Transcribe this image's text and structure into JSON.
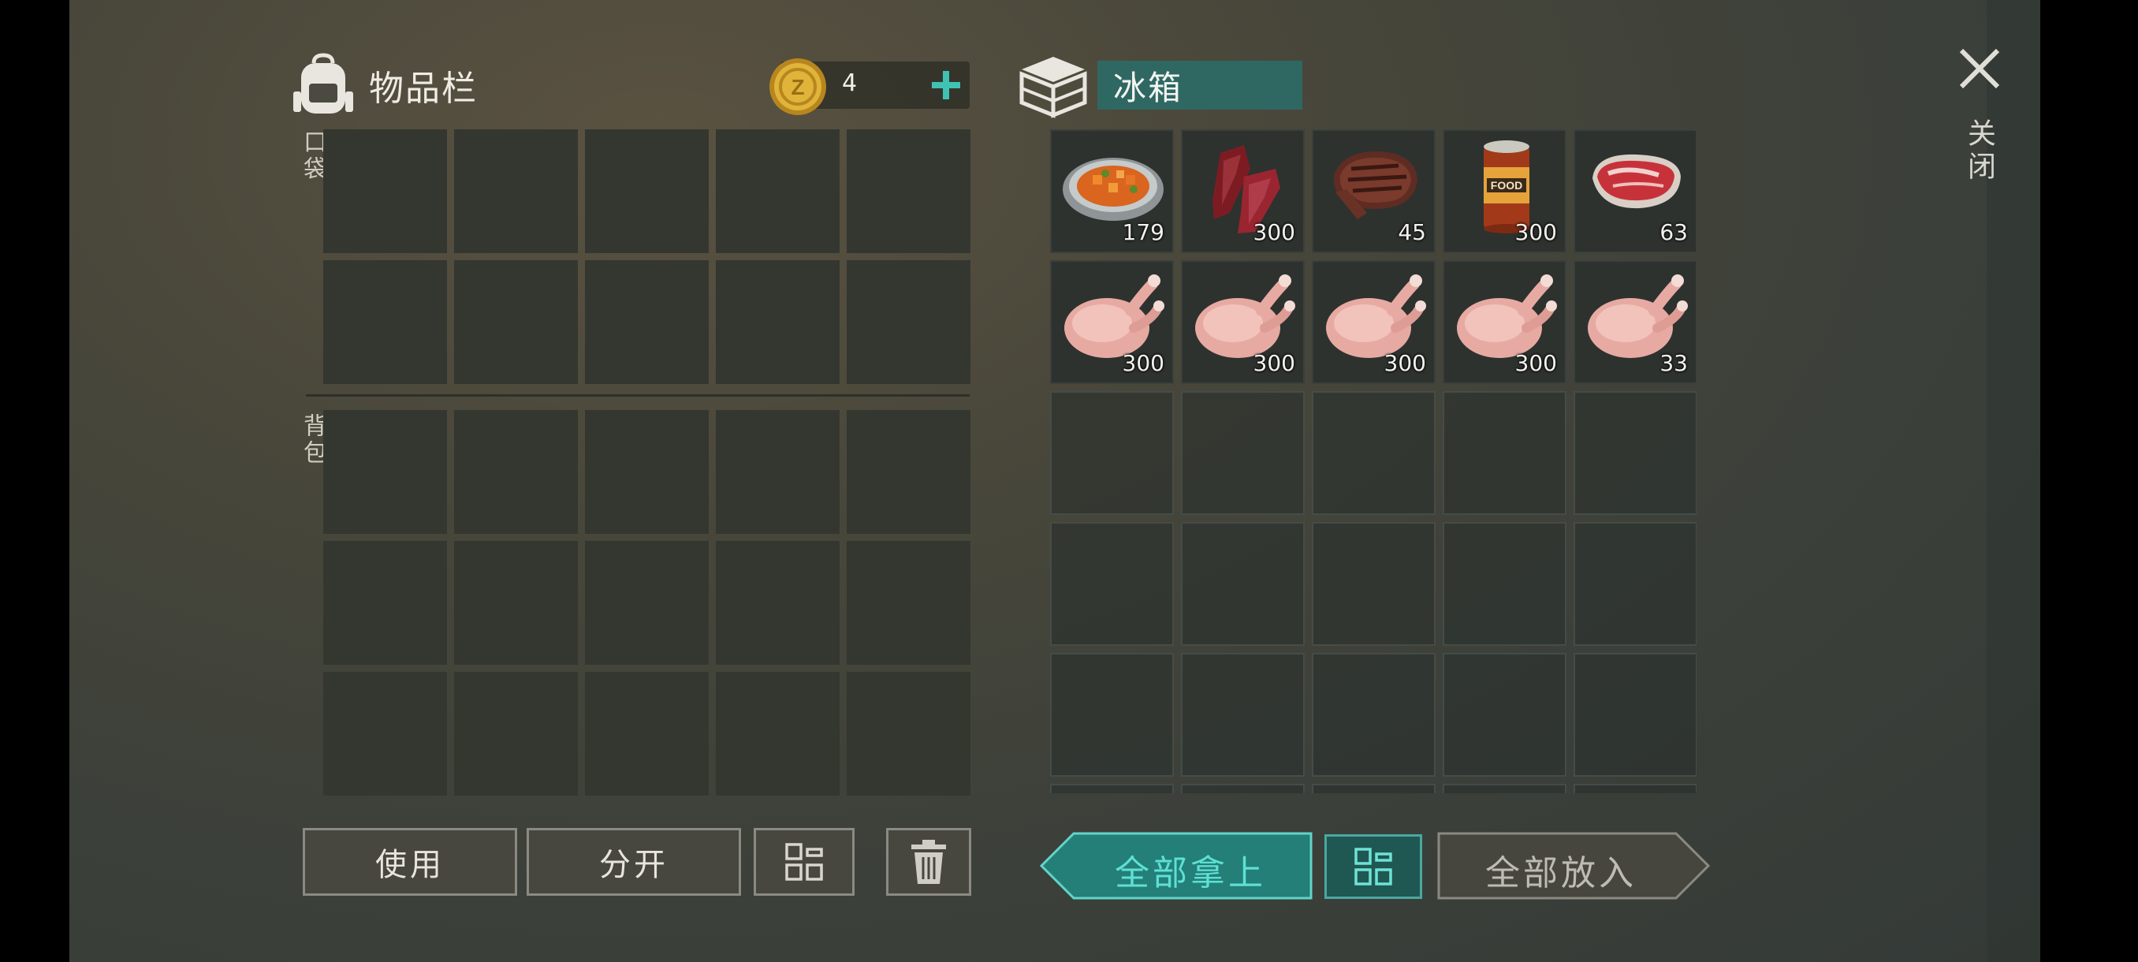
{
  "inventory": {
    "title": "物品栏",
    "coins": "4",
    "pocket_label": "口袋",
    "backpack_label": "背包"
  },
  "container": {
    "title": "冰箱",
    "items": [
      {
        "name": "carrot-stew-icon",
        "qty": "179"
      },
      {
        "name": "jerky-icon",
        "qty": "300"
      },
      {
        "name": "steak-icon",
        "qty": "45"
      },
      {
        "name": "canned-food-icon",
        "qty": "300"
      },
      {
        "name": "raw-meat-icon",
        "qty": "63"
      },
      {
        "name": "raw-chicken-icon",
        "qty": "300"
      },
      {
        "name": "raw-chicken-icon",
        "qty": "300"
      },
      {
        "name": "raw-chicken-icon",
        "qty": "300"
      },
      {
        "name": "raw-chicken-icon",
        "qty": "300"
      },
      {
        "name": "raw-chicken-icon",
        "qty": "33"
      }
    ],
    "can_label": "FOOD"
  },
  "close": {
    "label": "关闭"
  },
  "buttons": {
    "use": "使用",
    "split": "分开",
    "take_all": "全部拿上",
    "put_all": "全部放入"
  },
  "colors": {
    "accent": "#5ee0d3",
    "title_bg": "#2f6862",
    "coin": "#e0b43a"
  }
}
